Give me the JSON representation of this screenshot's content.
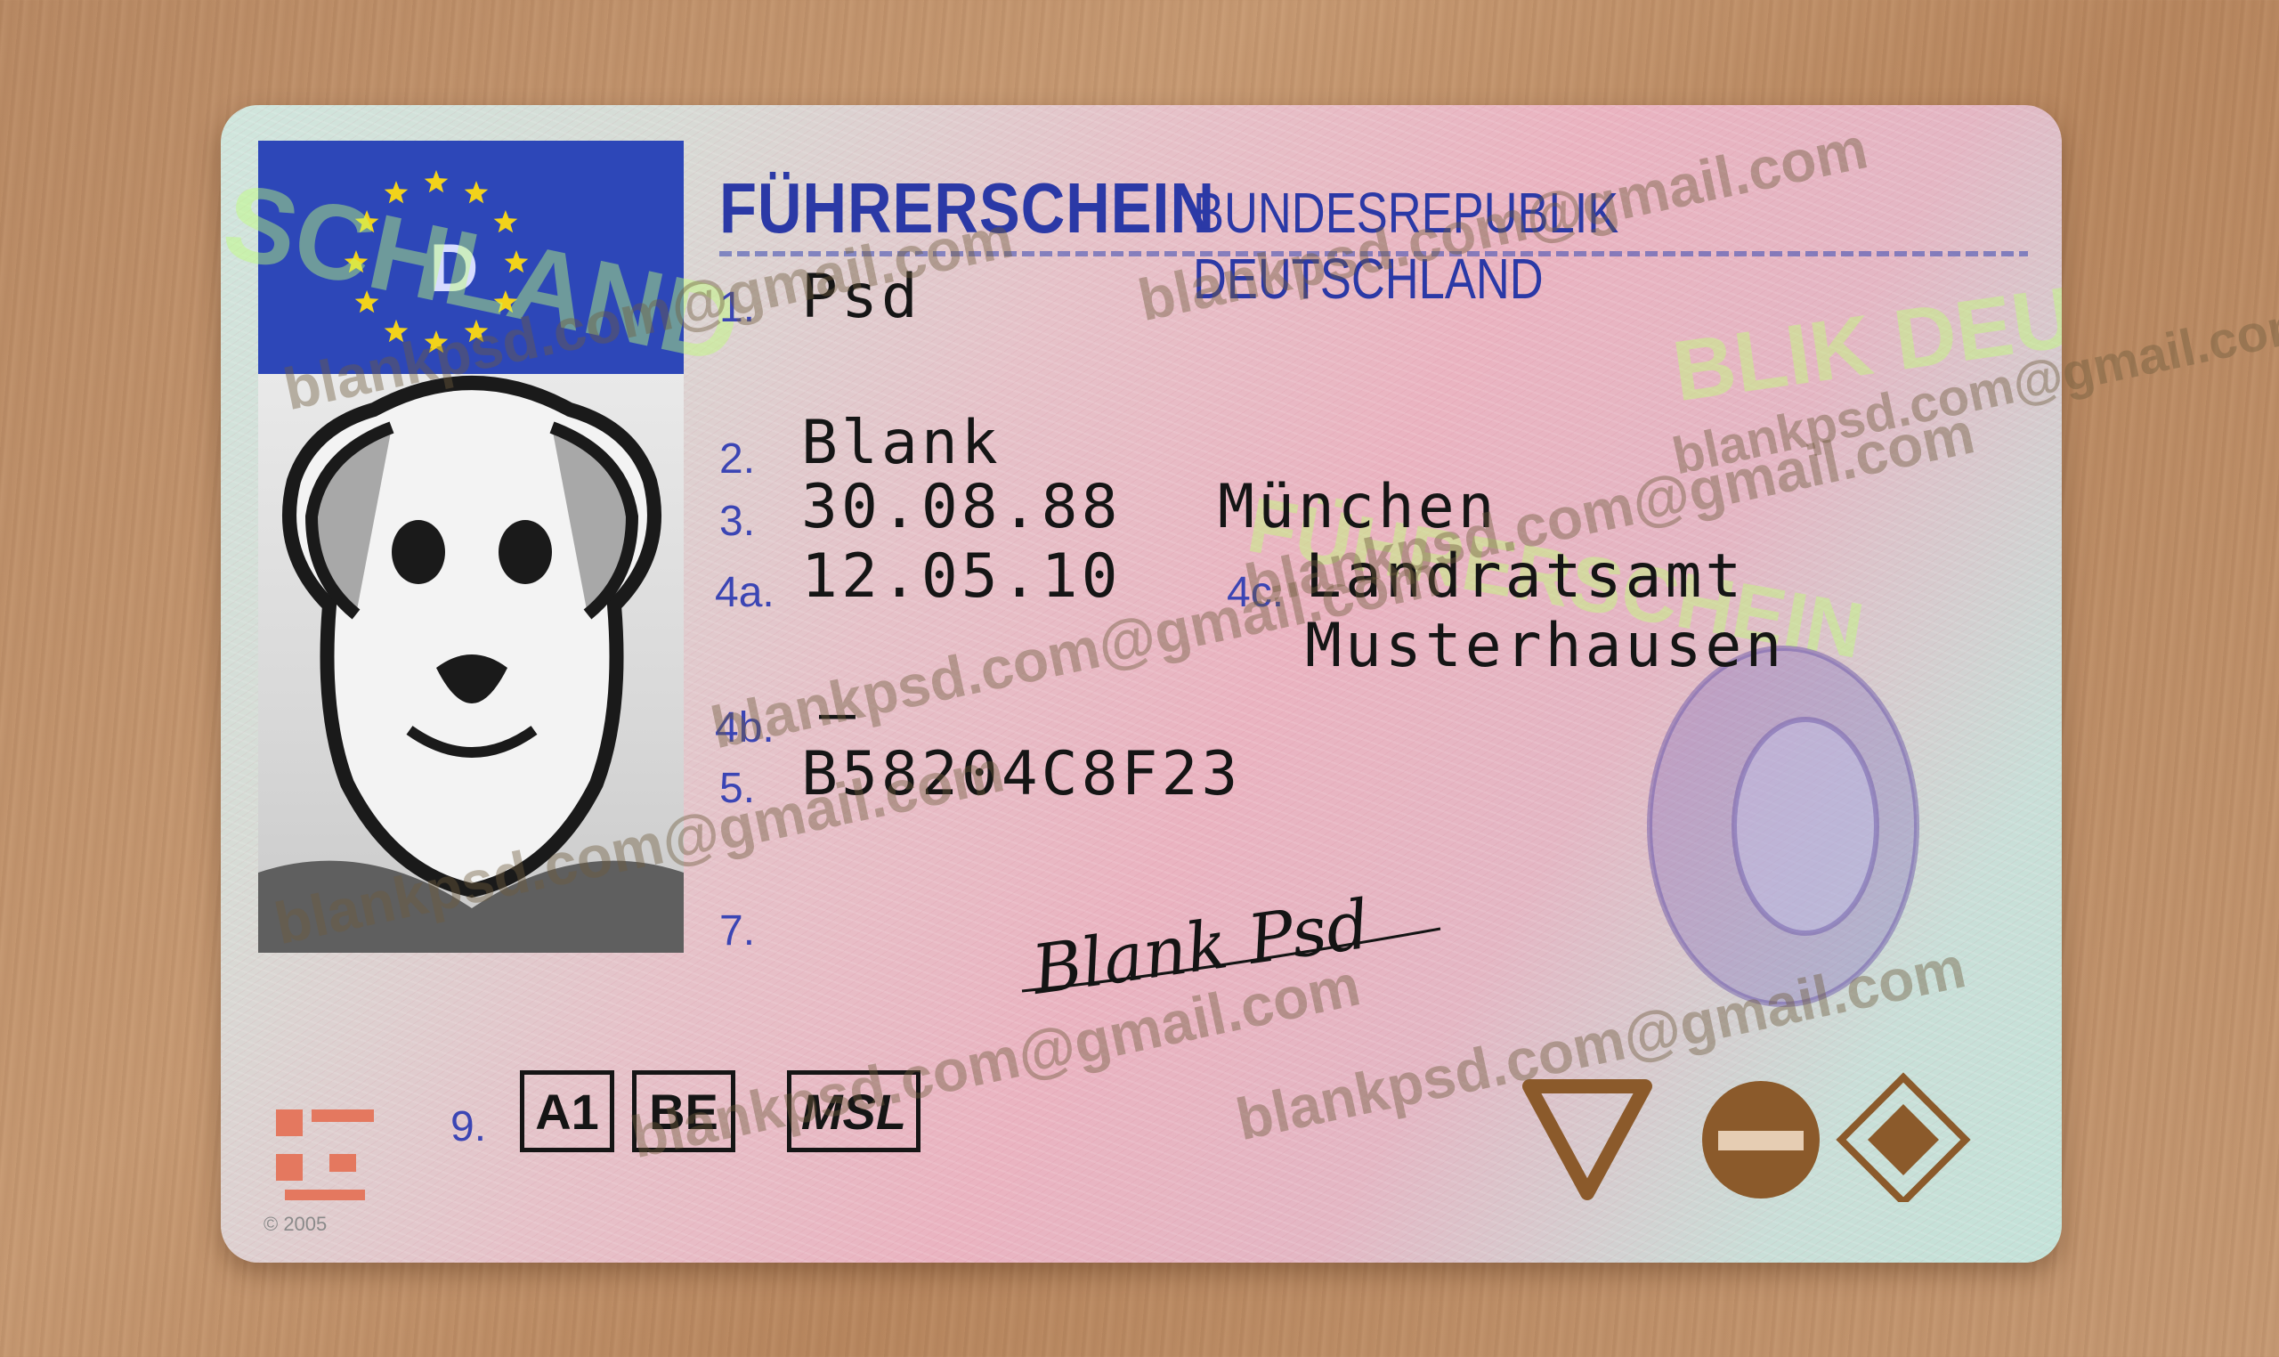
{
  "card": {
    "country_code": "D",
    "title": "FÜHRERSCHEIN",
    "country_name": "BUNDESREPUBLIK DEUTSCHLAND",
    "copyright": "© 2005"
  },
  "fields": [
    {
      "num": "1.",
      "value": "Psd"
    },
    {
      "num": "2.",
      "value": "Blank"
    },
    {
      "num": "3.",
      "value": "30.08.88",
      "extra": "München"
    },
    {
      "num": "4a.",
      "value": "12.05.10"
    },
    {
      "num": "4c.",
      "value": "Landratsamt",
      "value2": "Musterhausen"
    },
    {
      "num": "4b.",
      "value": "—"
    },
    {
      "num": "5.",
      "value": "B58204C8F23"
    },
    {
      "num": "7.",
      "value": "Blank Psd"
    },
    {
      "num": "9.",
      "value": ""
    }
  ],
  "categories": [
    "A1",
    "BE",
    "MSL"
  ],
  "holograms": [
    "SCHLAND",
    "BLIK DEUT",
    "FÜHRERSCHEIN"
  ],
  "watermark": "blankpsd.com@gmail.com",
  "colors": {
    "flag_blue": "#2d47b8",
    "title_blue": "#2b39a6",
    "stars": "#f2d21b",
    "symbol_brown": "#8b5a2b"
  }
}
